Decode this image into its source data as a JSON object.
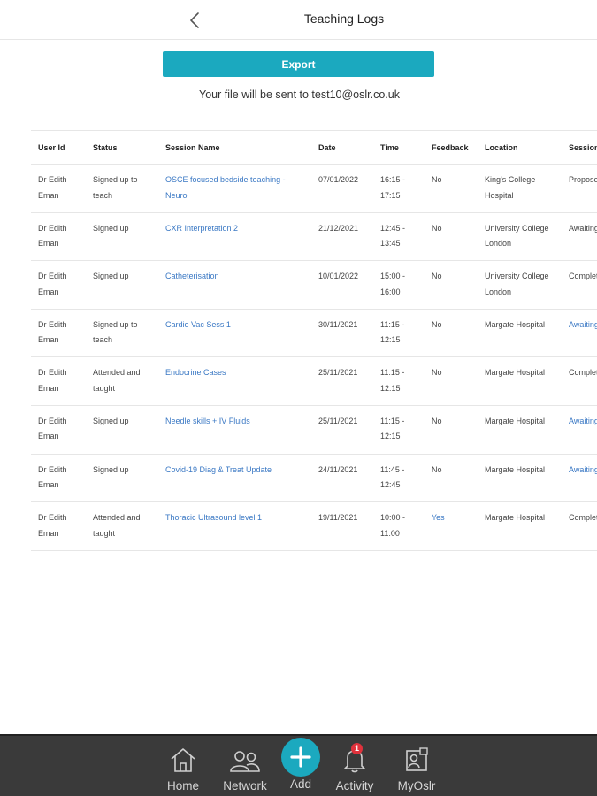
{
  "header": {
    "title": "Teaching Logs"
  },
  "export": {
    "button_label": "Export",
    "note": "Your file will be sent to test10@oslr.co.uk"
  },
  "table": {
    "columns": [
      "User Id",
      "Status",
      "Session Name",
      "Date",
      "Time",
      "Feedback",
      "Location",
      "Session Status"
    ],
    "rows": [
      {
        "user": "Dr Edith Eman",
        "status": "Signed up to teach",
        "session": "OSCE focused bedside teaching - Neuro",
        "date": "07/01/2022",
        "time": "16:15 - 17:15",
        "feedback": "No",
        "location": "King's College Hospital",
        "session_status": "Proposed"
      },
      {
        "user": "Dr Edith Eman",
        "status": "Signed up",
        "session": "CXR Interpretation 2",
        "date": "21/12/2021",
        "time": "12:45 - 13:45",
        "feedback": "No",
        "location": "University College London",
        "session_status": "Awaiting review"
      },
      {
        "user": "Dr Edith Eman",
        "status": "Signed up",
        "session": "Catheterisation",
        "date": "10/01/2022",
        "time": "15:00 - 16:00",
        "feedback": "No",
        "location": "University College London",
        "session_status": "Completed"
      },
      {
        "user": "Dr Edith Eman",
        "status": "Signed up to teach",
        "session": "Cardio Vac Sess 1",
        "date": "30/11/2021",
        "time": "11:15 - 12:15",
        "feedback": "No",
        "location": "Margate Hospital",
        "session_status": "Awaiting review"
      },
      {
        "user": "Dr Edith Eman",
        "status": "Attended and taught",
        "session": "Endocrine Cases",
        "date": "25/11/2021",
        "time": "11:15 - 12:15",
        "feedback": "No",
        "location": "Margate Hospital",
        "session_status": "Completed"
      },
      {
        "user": "Dr Edith Eman",
        "status": "Signed up",
        "session": "Needle skills + IV Fluids",
        "date": "25/11/2021",
        "time": "11:15 - 12:15",
        "feedback": "No",
        "location": "Margate Hospital",
        "session_status": "Awaiting review"
      },
      {
        "user": "Dr Edith Eman",
        "status": "Signed up",
        "session": "Covid-19 Diag & Treat Update",
        "date": "24/11/2021",
        "time": "11:45 - 12:45",
        "feedback": "No",
        "location": "Margate Hospital",
        "session_status": "Awaiting review"
      },
      {
        "user": "Dr Edith Eman",
        "status": "Attended and taught",
        "session": "Thoracic Ultrasound level 1",
        "date": "19/11/2021",
        "time": "10:00 - 11:00",
        "feedback": "Yes",
        "location": "Margate Hospital",
        "session_status": "Completed"
      }
    ]
  },
  "nav": {
    "items": [
      {
        "label": "Home",
        "icon": "home-icon"
      },
      {
        "label": "Network",
        "icon": "people-icon"
      },
      {
        "label": "Add",
        "icon": "plus-icon"
      },
      {
        "label": "Activity",
        "icon": "bell-icon",
        "badge": "1"
      },
      {
        "label": "MyOslr",
        "icon": "profile-card-icon"
      }
    ]
  },
  "colors": {
    "accent": "#1ba9bf",
    "link": "#3a78c4",
    "nav_bg": "#3a3a3a",
    "badge": "#e0323c"
  }
}
